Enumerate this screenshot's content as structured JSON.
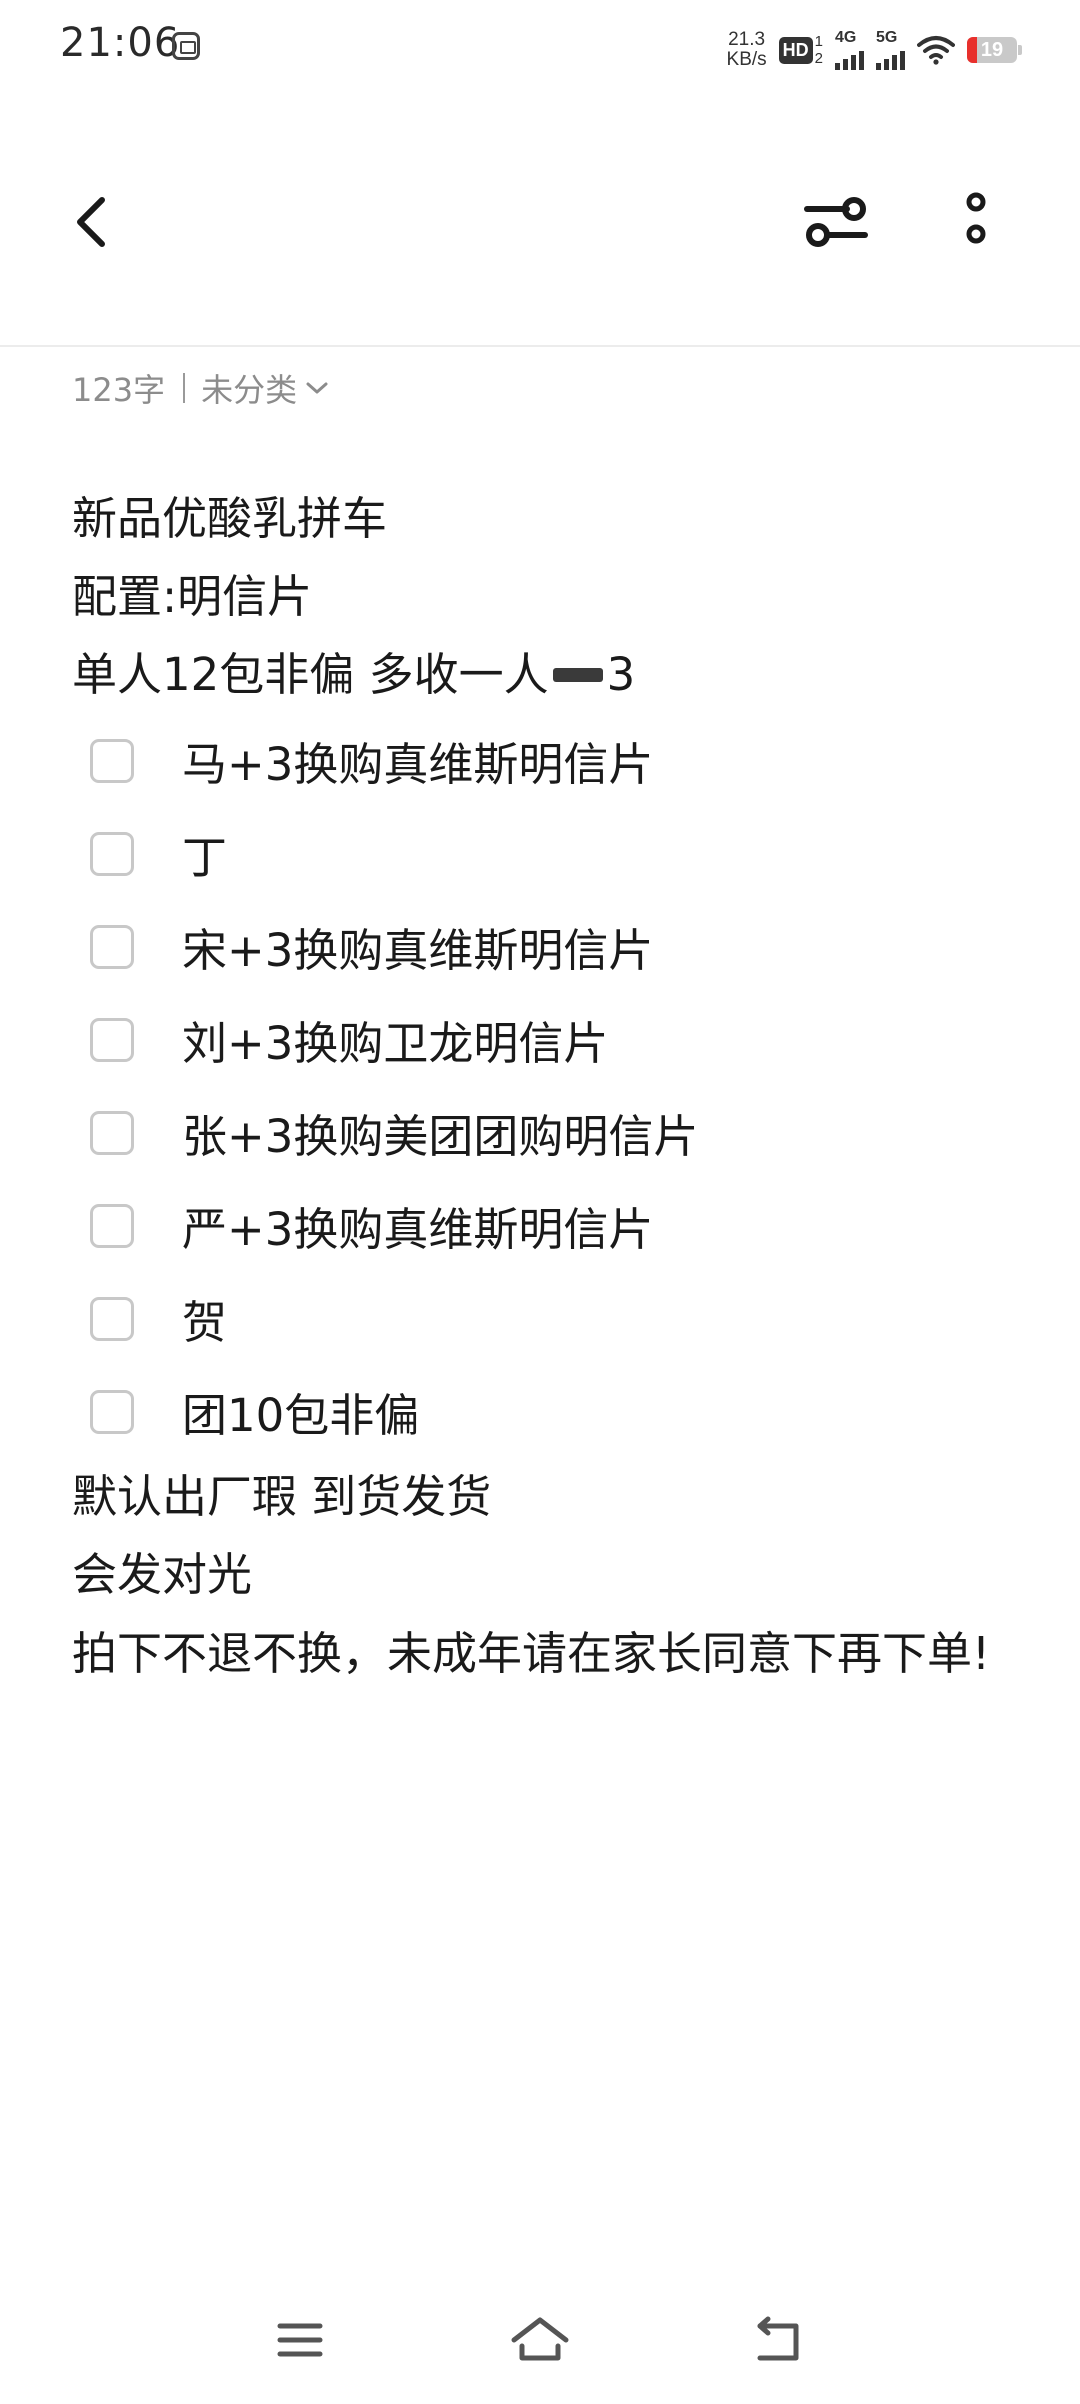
{
  "status_bar": {
    "time": "21:06",
    "net_speed_value": "21.3",
    "net_speed_unit": "KB/s",
    "hd_label": "HD",
    "hd_top": "1",
    "hd_bottom": "2",
    "sim1_label": "4G",
    "sim2_label": "5G",
    "battery_level": "19",
    "battery_fraction": 0.19,
    "battery_low_color": "#e8302c"
  },
  "toolbar": {
    "back_icon": "chevron-left-icon",
    "style_icon": "sliders-icon",
    "more_icon": "vertical-dots-icon"
  },
  "meta": {
    "word_count": "123字",
    "category": "未分类"
  },
  "note": {
    "lines": [
      "新品优酸乳拼车",
      "配置:明信片"
    ],
    "line3_before": "单人12包非偏 多收一人",
    "line3_after": "3",
    "todos": [
      {
        "text": "马+3换购真维斯明信片",
        "checked": false
      },
      {
        "text": "丁",
        "checked": false
      },
      {
        "text": "宋+3换购真维斯明信片",
        "checked": false
      },
      {
        "text": "刘+3换购卫龙明信片",
        "checked": false
      },
      {
        "text": "张+3换购美团团购明信片",
        "checked": false
      },
      {
        "text": "严+3换购真维斯明信片",
        "checked": false
      },
      {
        "text": "贺",
        "checked": false
      },
      {
        "text": "团10包非偏",
        "checked": false
      }
    ],
    "after_lines": [
      "默认出厂瑕 到货发货",
      "会发对光"
    ],
    "final_paragraph": "拍下不退不换，未成年请在家长同意下再下单!"
  },
  "nav_bar": {
    "menu_icon": "hamburger-icon",
    "home_icon": "home-icon",
    "back_icon": "return-icon"
  }
}
